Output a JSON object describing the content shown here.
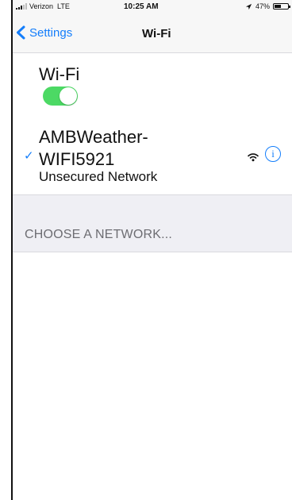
{
  "status_bar": {
    "carrier": "Verizon",
    "network_type": "LTE",
    "time": "10:25 AM",
    "battery_percent": "47%",
    "battery_level": 0.47
  },
  "navigation": {
    "back_label": "Settings",
    "title": "Wi-Fi"
  },
  "wifi_toggle": {
    "label": "Wi-Fi",
    "state": "on"
  },
  "connected_network": {
    "name_line1": "AMBWeather-",
    "name_line2": "WIFI5921",
    "security_status": "Unsecured Network",
    "selected": true
  },
  "section": {
    "choose_network": "CHOOSE A NETWORK..."
  },
  "colors": {
    "accent": "#147efb",
    "toggle_on": "#4cd964",
    "group_background": "#efeff4",
    "section_text": "#6d6d72"
  },
  "icons": {
    "signal": "cell-signal-icon",
    "location": "location-arrow-icon",
    "battery": "battery-icon",
    "back": "chevron-left-icon",
    "checkmark": "checkmark-icon",
    "wifi_strength": "wifi-signal-icon",
    "info": "info-icon"
  }
}
